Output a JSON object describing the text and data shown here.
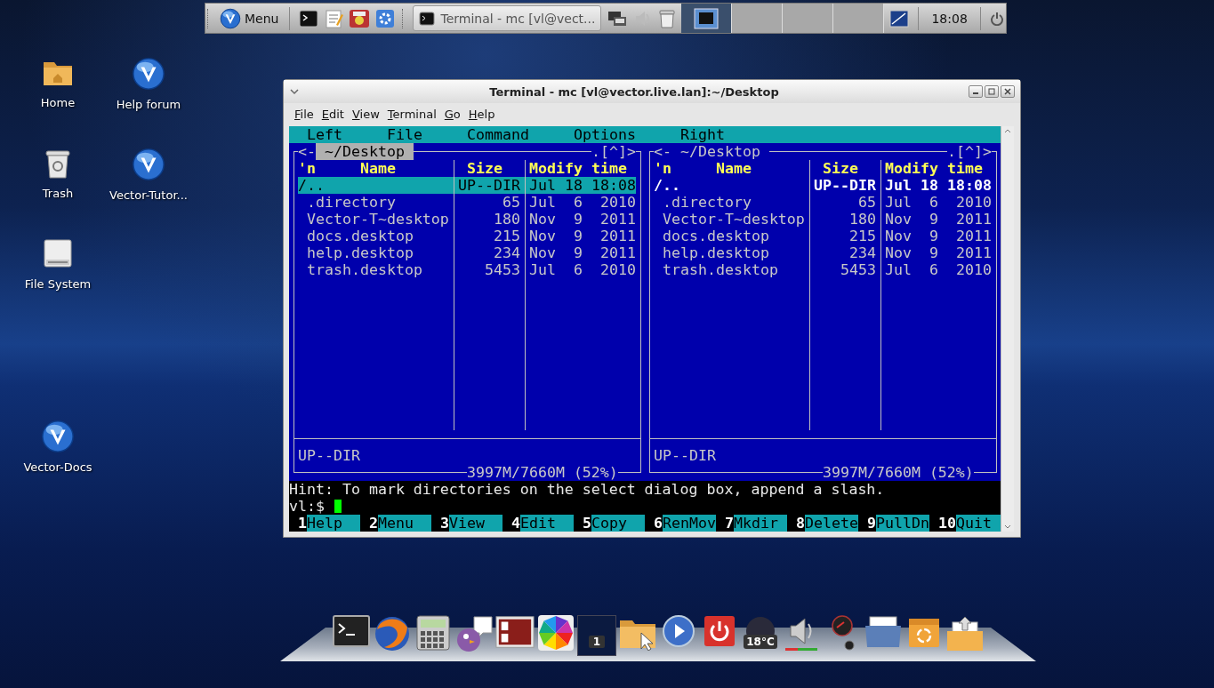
{
  "top_panel": {
    "menu_label": "Menu",
    "task_title": "Terminal - mc [vl@vect...",
    "pager": [
      {
        "selected": true
      },
      {
        "selected": false
      },
      {
        "selected": false
      },
      {
        "selected": false
      }
    ],
    "clock": "18:08"
  },
  "desktop_icons": [
    {
      "label": "Home",
      "kind": "folder"
    },
    {
      "label": "Help forum",
      "kind": "logo"
    },
    {
      "label": "Trash",
      "kind": "trash"
    },
    {
      "label": "Vector-Tutor...",
      "kind": "logo"
    },
    {
      "label": "File System",
      "kind": "drive"
    },
    {
      "label": "Vector-Docs",
      "kind": "logo"
    }
  ],
  "window": {
    "title": "Terminal - mc [vl@vector.live.lan]:~/Desktop",
    "menu": [
      "File",
      "Edit",
      "View",
      "Terminal",
      "Go",
      "Help"
    ]
  },
  "mc": {
    "menubar": [
      "Left",
      "File",
      "Command",
      "Options",
      "Right"
    ],
    "panels": [
      {
        "path": " ~/Desktop ",
        "active": true,
        "left_mark": "<-",
        "right_mark": ".[^]>",
        "columns": [
          "'n",
          "Name",
          "Size",
          "Modify time"
        ],
        "rows": [
          {
            "kind": "dir",
            "name": "/..",
            "size": "UP--DIR",
            "modified": "Jul 18 18:08",
            "selected": true
          },
          {
            "kind": "file",
            "name": ".directory",
            "size": "65",
            "modified": "Jul  6  2010",
            "selected": false
          },
          {
            "kind": "file",
            "name": "Vector-T~desktop",
            "size": "180",
            "modified": "Nov  9  2011",
            "selected": false
          },
          {
            "kind": "file",
            "name": "docs.desktop",
            "size": "215",
            "modified": "Nov  9  2011",
            "selected": false
          },
          {
            "kind": "file",
            "name": "help.desktop",
            "size": "234",
            "modified": "Nov  9  2011",
            "selected": false
          },
          {
            "kind": "file",
            "name": "trash.desktop",
            "size": "5453",
            "modified": "Jul  6  2010",
            "selected": false
          }
        ],
        "status": "UP--DIR",
        "free": "3997M/7660M (52%)"
      },
      {
        "path": " ~/Desktop ",
        "active": false,
        "left_mark": "<-",
        "right_mark": ".[^]>",
        "columns": [
          "'n",
          "Name",
          "Size",
          "Modify time"
        ],
        "rows": [
          {
            "kind": "dir",
            "name": "/..",
            "size": "UP--DIR",
            "modified": "Jul 18 18:08",
            "selected": true
          },
          {
            "kind": "file",
            "name": ".directory",
            "size": "65",
            "modified": "Jul  6  2010",
            "selected": false
          },
          {
            "kind": "file",
            "name": "Vector-T~desktop",
            "size": "180",
            "modified": "Nov  9  2011",
            "selected": false
          },
          {
            "kind": "file",
            "name": "docs.desktop",
            "size": "215",
            "modified": "Nov  9  2011",
            "selected": false
          },
          {
            "kind": "file",
            "name": "help.desktop",
            "size": "234",
            "modified": "Nov  9  2011",
            "selected": false
          },
          {
            "kind": "file",
            "name": "trash.desktop",
            "size": "5453",
            "modified": "Jul  6  2010",
            "selected": false
          }
        ],
        "status": "UP--DIR",
        "free": "3997M/7660M (52%)"
      }
    ],
    "hint": "Hint: To mark directories on the select dialog box, append a slash.",
    "prompt": "vl:$",
    "keys": [
      {
        "number": "1",
        "label": "Help"
      },
      {
        "number": "2",
        "label": "Menu"
      },
      {
        "number": "3",
        "label": "View"
      },
      {
        "number": "4",
        "label": "Edit"
      },
      {
        "number": "5",
        "label": "Copy"
      },
      {
        "number": "6",
        "label": "RenMov"
      },
      {
        "number": "7",
        "label": "Mkdir"
      },
      {
        "number": "8",
        "label": "Delete"
      },
      {
        "number": "9",
        "label": "PullDn"
      },
      {
        "number": "10",
        "label": "Quit"
      }
    ]
  },
  "dock": {
    "pager_number": "1",
    "temperature": "18°C"
  }
}
